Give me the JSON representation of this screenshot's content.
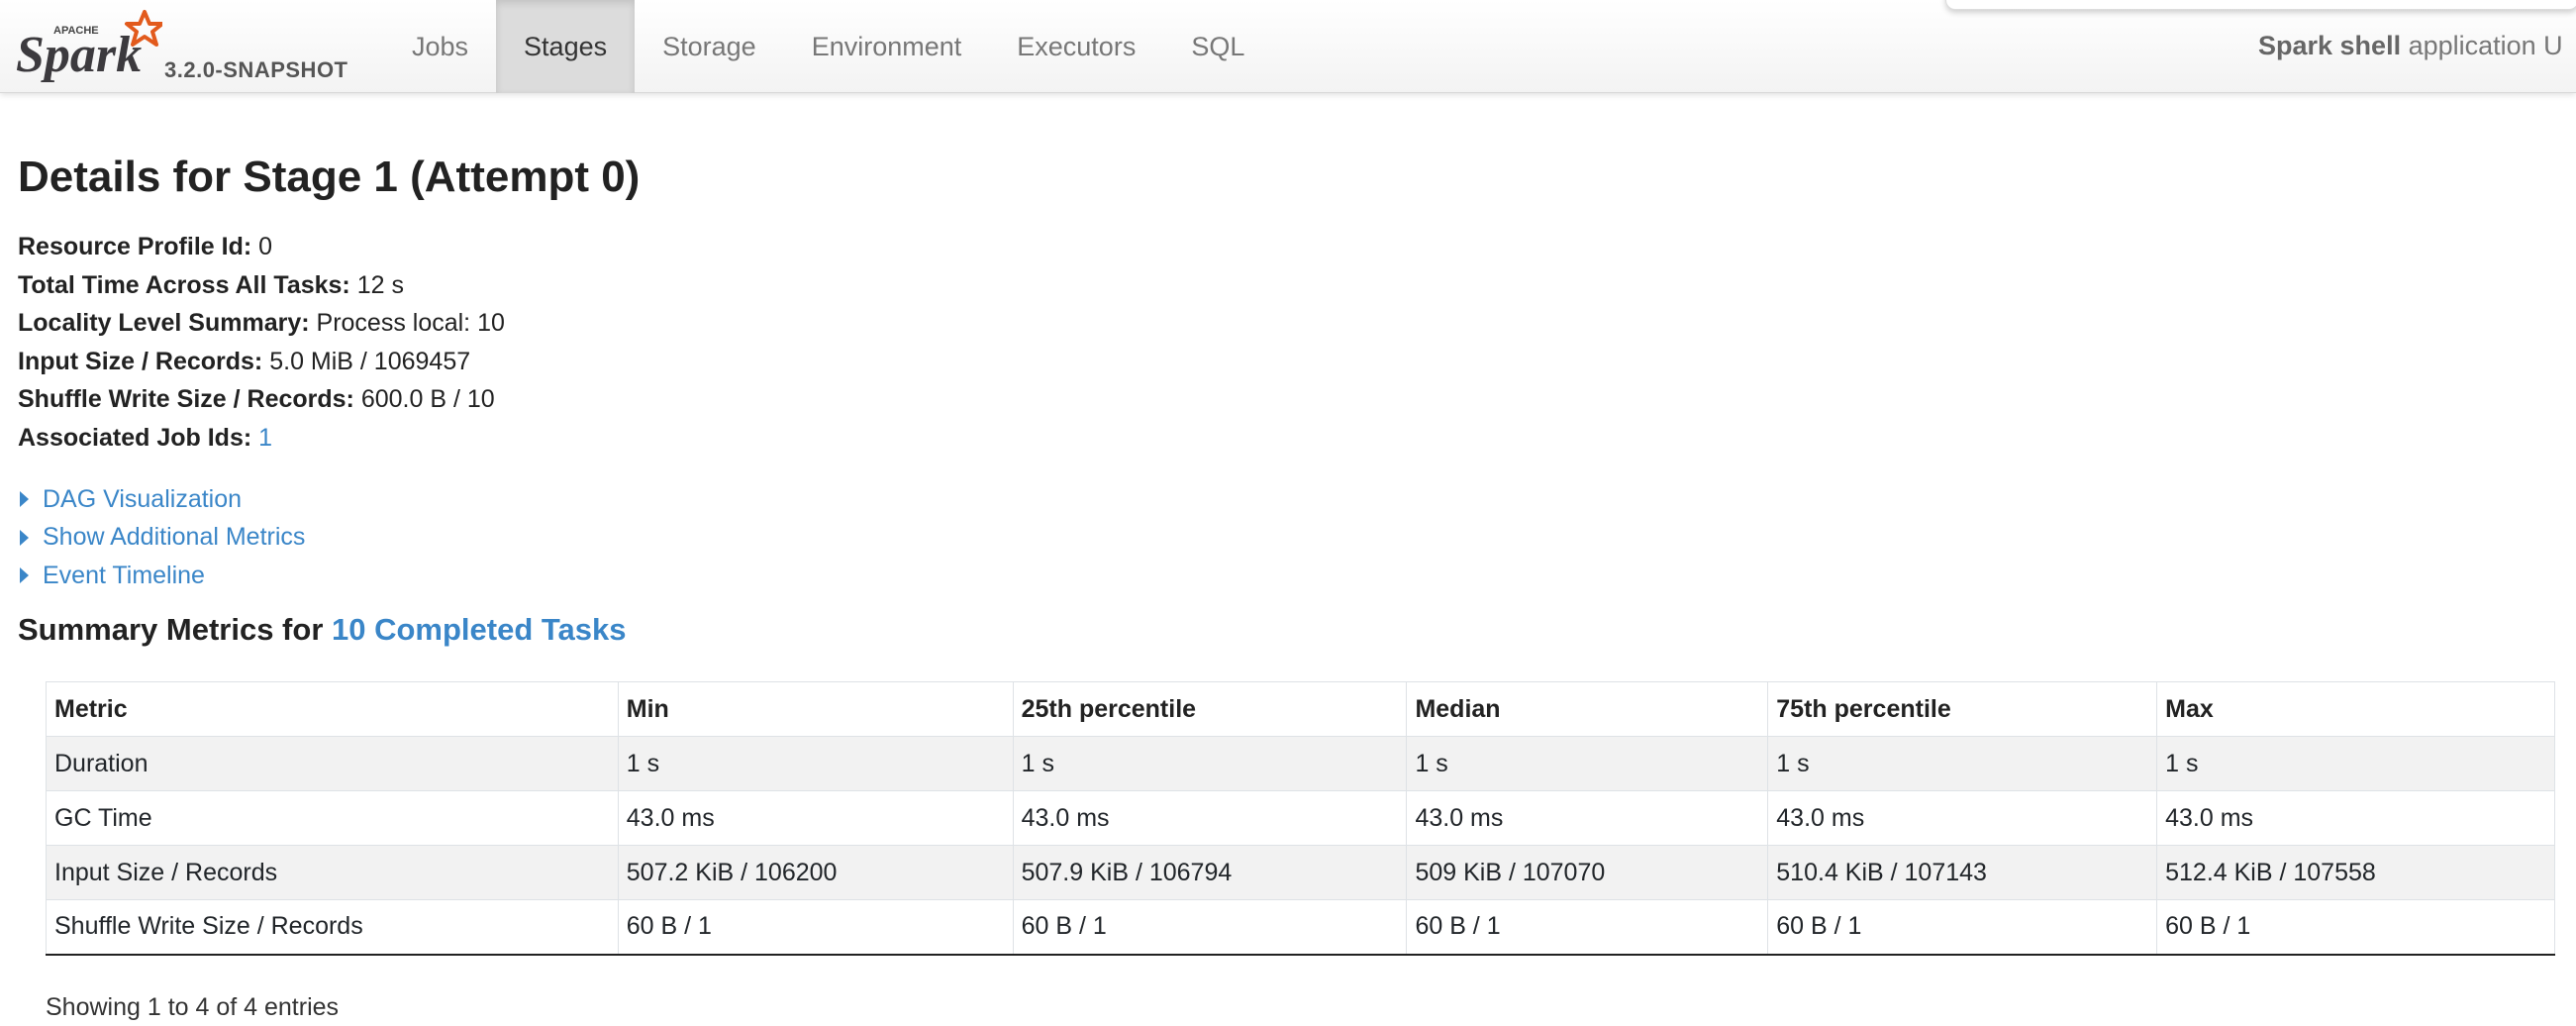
{
  "brand": {
    "logo_text": "Spark",
    "logo_apache": "APACHE",
    "version": "3.2.0-SNAPSHOT"
  },
  "nav": {
    "tabs": [
      {
        "label": "Jobs",
        "active": false
      },
      {
        "label": "Stages",
        "active": true
      },
      {
        "label": "Storage",
        "active": false
      },
      {
        "label": "Environment",
        "active": false
      },
      {
        "label": "Executors",
        "active": false
      },
      {
        "label": "SQL",
        "active": false
      }
    ],
    "app_name_bold": "Spark shell",
    "app_name_rest": " application U"
  },
  "page": {
    "title": "Details for Stage 1 (Attempt 0)"
  },
  "details": {
    "resource_profile_label": "Resource Profile Id:",
    "resource_profile_value": "0",
    "total_time_label": "Total Time Across All Tasks:",
    "total_time_value": "12 s",
    "locality_label": "Locality Level Summary:",
    "locality_value": "Process local: 10",
    "input_label": "Input Size / Records:",
    "input_value": "5.0 MiB / 1069457",
    "shuffle_label": "Shuffle Write Size / Records:",
    "shuffle_value": "600.0 B / 10",
    "job_ids_label": "Associated Job Ids:",
    "job_ids_value": "1"
  },
  "expanders": {
    "dag": "DAG Visualization",
    "additional": "Show Additional Metrics",
    "timeline": "Event Timeline"
  },
  "summary": {
    "prefix": "Summary Metrics for ",
    "link": "10 Completed Tasks"
  },
  "table": {
    "headers": [
      "Metric",
      "Min",
      "25th percentile",
      "Median",
      "75th percentile",
      "Max"
    ],
    "rows": [
      [
        "Duration",
        "1 s",
        "1 s",
        "1 s",
        "1 s",
        "1 s"
      ],
      [
        "GC Time",
        "43.0 ms",
        "43.0 ms",
        "43.0 ms",
        "43.0 ms",
        "43.0 ms"
      ],
      [
        "Input Size / Records",
        "507.2 KiB / 106200",
        "507.9 KiB / 106794",
        "509 KiB / 107070",
        "510.4 KiB / 107143",
        "512.4 KiB / 107558"
      ],
      [
        "Shuffle Write Size / Records",
        "60 B / 1",
        "60 B / 1",
        "60 B / 1",
        "60 B / 1",
        "60 B / 1"
      ]
    ]
  },
  "entries_text": "Showing 1 to 4 of 4 entries",
  "colors": {
    "link": "#3a86c8",
    "logo_orange": "#e25a1c",
    "active_tab": "#dcdcdc"
  }
}
